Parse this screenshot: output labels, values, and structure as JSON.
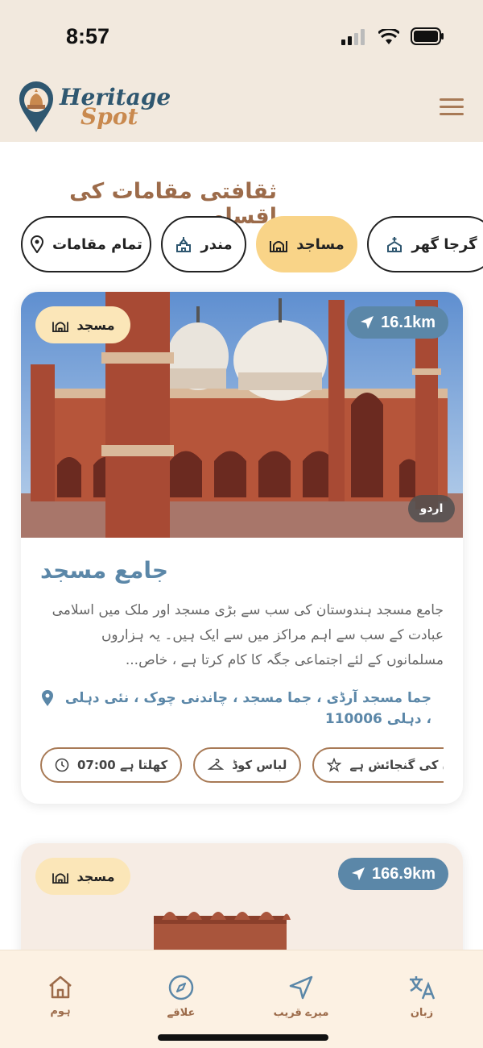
{
  "status_bar": {
    "time": "8:57"
  },
  "header": {
    "logo_line1": "Heritage",
    "logo_line2": "Spot"
  },
  "section_title": "ثقافتی مقامات کی اقسام",
  "categories": [
    {
      "label": "گرجا گھر",
      "icon": "church-icon"
    },
    {
      "label": "مساجد",
      "icon": "mosque-icon",
      "active": true
    },
    {
      "label": "مندر",
      "icon": "temple-icon"
    },
    {
      "label": "تمام مقامات",
      "icon": "location-pin-icon"
    }
  ],
  "cards": [
    {
      "type_badge": "مسجد",
      "distance": "16.1km",
      "language_badge": "اردو",
      "title": "جامع مسجد",
      "description": "جامع مسجد ہندوستان کی سب سے بڑی مسجد اور ملک میں اسلامی عبادت کے سب سے اہم مراکز میں سے ایک ہیں۔ یہ ہزاروں مسلمانوں کے لئے اجتماعی جگہ کا کام کرتا ہے ، خاص...",
      "address": "جما مسجد آرڈی ، جما مسجد ، چاندنی چوک ، نئی دہلی ، دہلی 110006",
      "tags": [
        {
          "label": "کھلتا ہے 07:00",
          "icon": "clock-icon"
        },
        {
          "label": "لباس کوڈ",
          "icon": "hanger-icon"
        },
        {
          "label": "نمازیوں کی گنجائش ہے",
          "icon": "star-icon"
        }
      ]
    },
    {
      "type_badge": "مسجد",
      "distance": "166.9km"
    }
  ],
  "bottom_nav": [
    {
      "label": "زبان",
      "icon": "translate-icon"
    },
    {
      "label": "میرے قریب",
      "icon": "navigation-arrow-icon"
    },
    {
      "label": "علاقے",
      "icon": "compass-icon"
    },
    {
      "label": "ہوم",
      "icon": "home-icon"
    }
  ],
  "colors": {
    "accent": "#5b87a8",
    "brown": "#9c6b4a",
    "chip_active": "#f9d488",
    "header_bg": "#f2e9de"
  }
}
